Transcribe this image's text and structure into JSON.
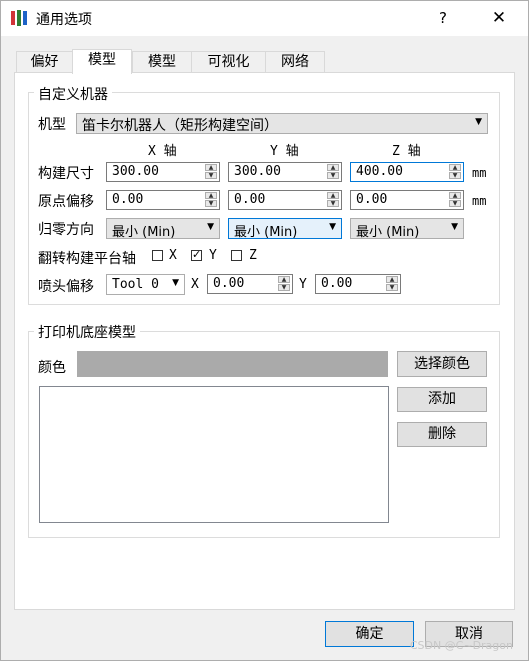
{
  "window": {
    "title": "通用选项",
    "help": "?",
    "close": "✕"
  },
  "tabs": [
    "偏好",
    "模型",
    "模型",
    "可视化",
    "网络"
  ],
  "custom_machine": {
    "group_title": "自定义机器",
    "machine_label": "机型",
    "machine_value": "笛卡尔机器人（矩形构建空间）",
    "axis_headers": [
      "X 轴",
      "Y 轴",
      "Z 轴"
    ],
    "build_size": {
      "label": "构建尺寸",
      "x": "300.00",
      "y": "300.00",
      "z": "400.00",
      "unit": "mm"
    },
    "origin_offset": {
      "label": "原点偏移",
      "x": "0.00",
      "y": "0.00",
      "z": "0.00",
      "unit": "mm"
    },
    "homing": {
      "label": "归零方向",
      "x": "最小 (Min)",
      "y": "最小 (Min)",
      "z": "最小 (Min)"
    },
    "flip_axis": {
      "label": "翻转构建平台轴",
      "options": [
        {
          "label": "X",
          "checked": false
        },
        {
          "label": "Y",
          "checked": true
        },
        {
          "label": "Z",
          "checked": false
        }
      ]
    },
    "nozzle_offset": {
      "label": "喷头偏移",
      "tool": "Tool 0",
      "x_label": "X",
      "x": "0.00",
      "y_label": "Y",
      "y": "0.00"
    }
  },
  "printer_base": {
    "group_title": "打印机底座模型",
    "color_label": "颜色",
    "color": "#aaaaaa",
    "choose_color_button": "选择颜色",
    "add_button": "添加",
    "delete_button": "删除"
  },
  "footer": {
    "ok": "确定",
    "cancel": "取消"
  },
  "watermark": "CSDN @C~Dragon"
}
